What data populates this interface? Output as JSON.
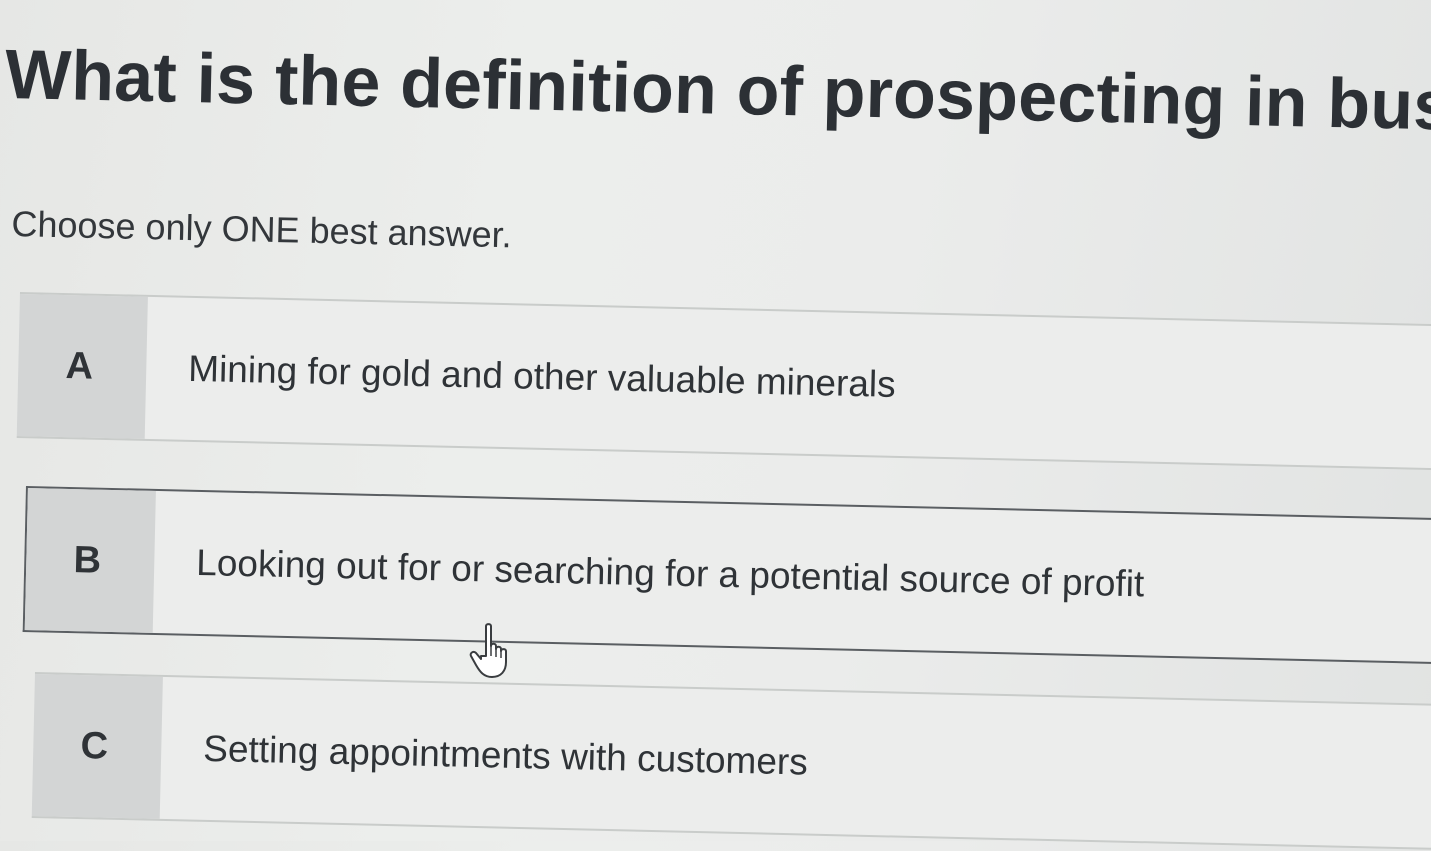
{
  "question": {
    "title": "What is the definition of prospecting in busine",
    "instruction": "Choose only ONE best answer."
  },
  "options": [
    {
      "letter": "A",
      "text": "Mining for gold and other valuable minerals"
    },
    {
      "letter": "B",
      "text": "Looking out for or searching for a potential source of profit"
    },
    {
      "letter": "C",
      "text": "Setting appointments with customers"
    }
  ],
  "cursor": {
    "icon": "hand-pointer-icon"
  }
}
